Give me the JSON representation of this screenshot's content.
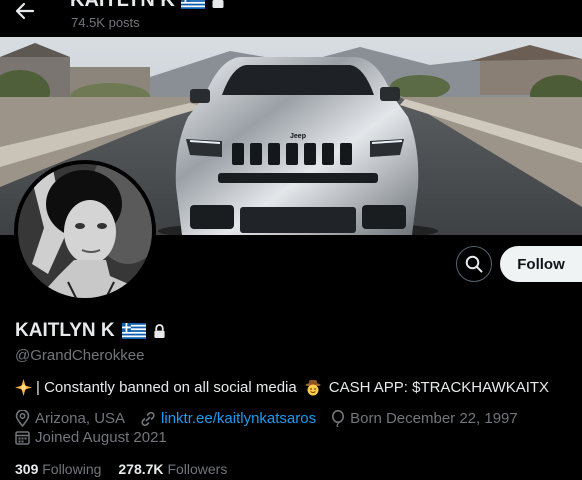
{
  "header": {
    "display_name": "KAITLYN K",
    "post_count": "74.5K posts"
  },
  "profile": {
    "display_name": "KAITLYN K",
    "handle": "@GrandCherokkee",
    "bio_text": "| Constantly banned on all social media",
    "bio_cash": "CASH APP: $TRACKHAWKAITX",
    "location": "Arizona, USA",
    "website": "linktr.ee/kaitlynkatsaros",
    "birthday": "Born December 22, 1997",
    "joined": "Joined August 2021",
    "following_count": "309",
    "following_label": "Following",
    "followers_count": "278.7K",
    "followers_label": "Followers"
  },
  "actions": {
    "follow_label": "Follow"
  },
  "banner": {
    "grille_badge": "Jeep"
  },
  "icons": {
    "back": "arrow-left-icon",
    "lock": "lock-icon",
    "flag": "greece-flag-icon",
    "search": "search-icon",
    "location": "location-pin-icon",
    "link": "link-icon",
    "birthday": "balloon-icon",
    "calendar": "calendar-icon",
    "sparkle": "sparkle-emoji-icon",
    "cowboy": "cowboy-emoji-icon"
  },
  "colors": {
    "background": "#000000",
    "text": "#e7e9ea",
    "muted": "#71767b",
    "link": "#1d9bf0",
    "follow_button": "#eff3f4"
  }
}
